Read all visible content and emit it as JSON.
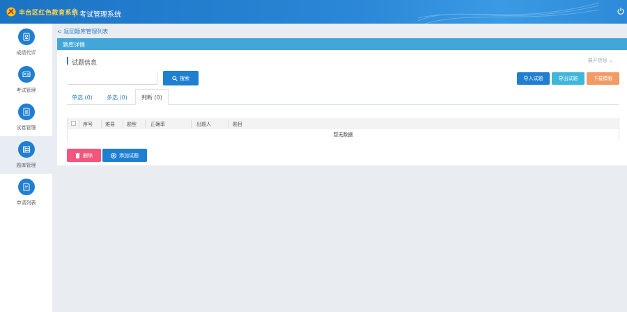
{
  "header": {
    "org_name": "丰台区红色教育系统",
    "system_title": "考试管理系统",
    "logo_icon": "party-emblem-icon",
    "power_icon": "power-icon"
  },
  "sidebar": {
    "items": [
      {
        "label": "成绩代评",
        "icon": "exam-icon"
      },
      {
        "label": "考试管理",
        "icon": "id-card-icon"
      },
      {
        "label": "试卷管理",
        "icon": "document-icon"
      },
      {
        "label": "题库管理",
        "icon": "list-icon"
      },
      {
        "label": "申请列表",
        "icon": "edit-doc-icon"
      }
    ],
    "active_index": 3
  },
  "main": {
    "back_link": "< 返回题库管理列表",
    "title_bar": "题库详情",
    "section_title": "试题信息",
    "collapse_label": "展开信息",
    "search": {
      "value": "",
      "placeholder": "",
      "button_label": "搜索"
    },
    "actions": {
      "import_label": "导入试题",
      "export_label": "导出试题",
      "template_label": "下载模板"
    },
    "tabs": [
      {
        "label": "单选 (0)"
      },
      {
        "label": "多选 (0)"
      },
      {
        "label": "判断 (0)"
      }
    ],
    "active_tab": 2,
    "table": {
      "columns": [
        "序号",
        "难易",
        "题型",
        "正确率",
        "出题人",
        "题目"
      ],
      "empty_text": "暂无数据"
    },
    "bottom": {
      "delete_label": "删除",
      "add_label": "添加试题"
    }
  },
  "colors": {
    "primary": "#1f7fd1",
    "title_bar": "#42a6d9",
    "export": "#3fb6dc",
    "template": "#f29a64",
    "delete": "#f2567d"
  }
}
